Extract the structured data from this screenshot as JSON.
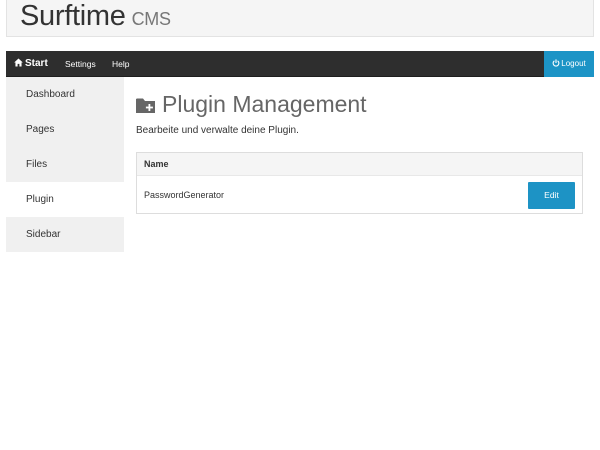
{
  "brand": {
    "title": "Surftime",
    "subtitle": "CMS"
  },
  "navbar": {
    "start_label": "Start",
    "settings_label": "Settings",
    "help_label": "Help",
    "logout_label": "Logout"
  },
  "sidebar": {
    "items": [
      {
        "label": "Dashboard"
      },
      {
        "label": "Pages"
      },
      {
        "label": "Files"
      },
      {
        "label": "Plugin"
      },
      {
        "label": "Sidebar"
      }
    ],
    "active": "Plugin"
  },
  "main": {
    "title": "Plugin Management",
    "description": "Bearbeite und verwalte deine Plugin.",
    "table": {
      "header": "Name",
      "rows": [
        {
          "name": "PasswordGenerator",
          "action": "Edit"
        }
      ]
    }
  },
  "colors": {
    "accent": "#1d93c5",
    "navbar": "#2e2e2e",
    "sidebar": "#f0f0f0"
  },
  "icons": {
    "start": "home-icon",
    "logout": "power-icon",
    "title": "folder-plus-icon"
  }
}
